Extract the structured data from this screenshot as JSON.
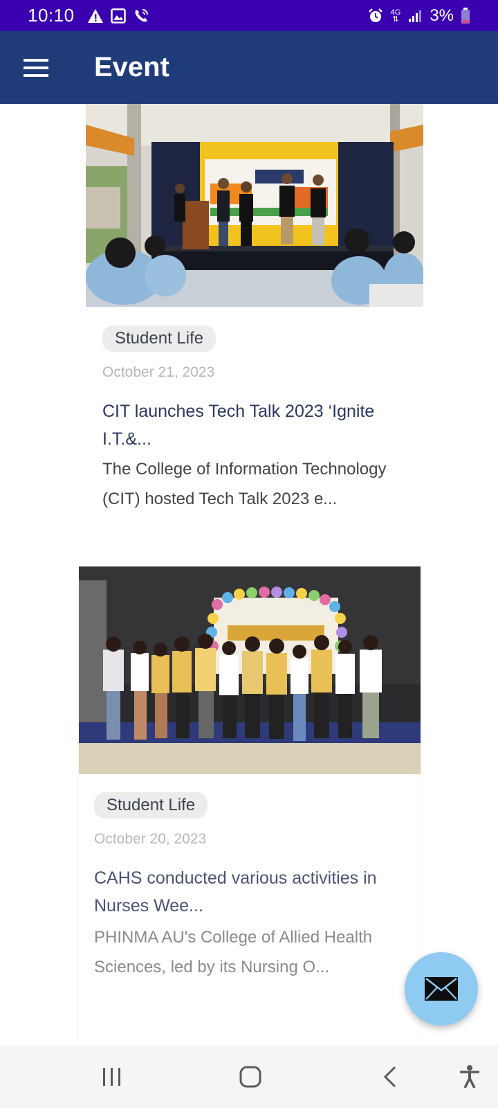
{
  "status_bar": {
    "time": "10:10",
    "battery": "3%",
    "network": "4G",
    "icons": [
      "warning-icon",
      "image-icon",
      "wifi-call-icon",
      "alarm-icon",
      "signal-icon",
      "battery-icon"
    ],
    "background_color": "#3a00b0"
  },
  "app_bar": {
    "title": "Event",
    "menu_icon": "hamburger-menu-icon",
    "background_color": "#1f3b78"
  },
  "events": [
    {
      "category": "Student Life",
      "date": "October 21, 2023",
      "title": "CIT launches Tech Talk 2023 ‘Ignite I.T.&...",
      "description": "The College of Information Technology (CIT) hosted Tech Talk 2023 e...",
      "image": "stage-event-photo"
    },
    {
      "category": "Student Life",
      "date": "October 20, 2023",
      "title": "CAHS conducted various activities in Nurses Wee...",
      "description": "PHINMA AU's College of Allied Health Sciences, led by its Nursing O...",
      "image": "group-photo"
    }
  ],
  "fab": {
    "icon": "mail-icon",
    "color": "#8ecaf2"
  },
  "nav_bar": {
    "buttons": [
      "recents-icon",
      "home-icon",
      "back-icon",
      "accessibility-icon"
    ]
  }
}
